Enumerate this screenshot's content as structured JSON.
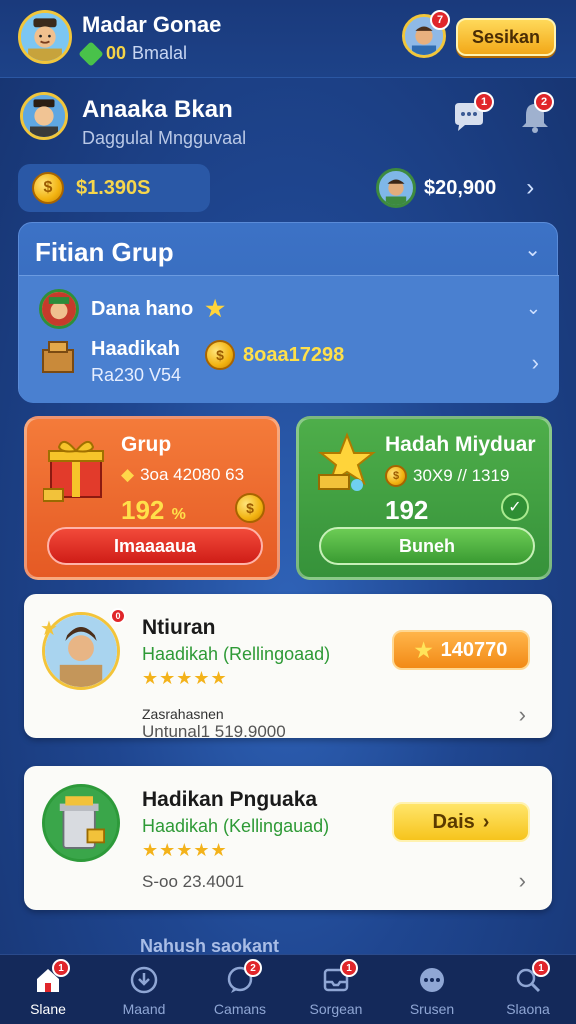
{
  "header": {
    "name": "Madar Gonae",
    "gems": "00",
    "gems_label": "Bmalal",
    "header_badge": "7",
    "settings_label": "Sesikan"
  },
  "profile": {
    "name": "Anaaka Bkan",
    "subtitle": "Daggulal Mngguvaal",
    "chat_badge": "1",
    "bell_badge": "2"
  },
  "balances": {
    "left": "$1.390S",
    "right": "$20,900"
  },
  "group": {
    "title": "Fitian Grup",
    "member_name": "Dana hano",
    "item_title": "Haadikah",
    "item_sub": "Ra230 V54",
    "item_amount": "8oaa17298"
  },
  "cards": [
    {
      "title": "Grup",
      "sub": "3oa 42080 63",
      "big": "192",
      "big_suffix": "%",
      "cta": "Imaaaaua",
      "color": "#e55a24"
    },
    {
      "title": "Hadah Miyduar",
      "sub": "30X9 // 1319",
      "big": "192",
      "cta": "Buneh",
      "color": "#36923a"
    }
  ],
  "offers": [
    {
      "name": "Ntiuran",
      "desc": "Haadikah (Rellingoaad)",
      "stars": "★★★★★",
      "foot1": "Zasrahasnen",
      "foot2": "Untunal1 519.9000",
      "pill": "140770",
      "badge": "0"
    },
    {
      "name": "Hadikan Pnguaka",
      "desc": "Haadikah (Kellingauad)",
      "stars": "★★★★★",
      "foot1": "",
      "foot2": "S-oo 23.4001",
      "pill": "Dais"
    }
  ],
  "bottom_hint": "Nahush saokant",
  "nav": [
    {
      "label": "Slane",
      "badge": "1",
      "icon": "home-icon"
    },
    {
      "label": "Maand",
      "badge": "",
      "icon": "download-icon"
    },
    {
      "label": "Camans",
      "badge": "2",
      "icon": "chat-icon"
    },
    {
      "label": "Sorgean",
      "badge": "1",
      "icon": "inbox-icon"
    },
    {
      "label": "Srusen",
      "badge": "",
      "icon": "dots-icon"
    },
    {
      "label": "Slaona",
      "badge": "1",
      "icon": "search-icon"
    }
  ]
}
